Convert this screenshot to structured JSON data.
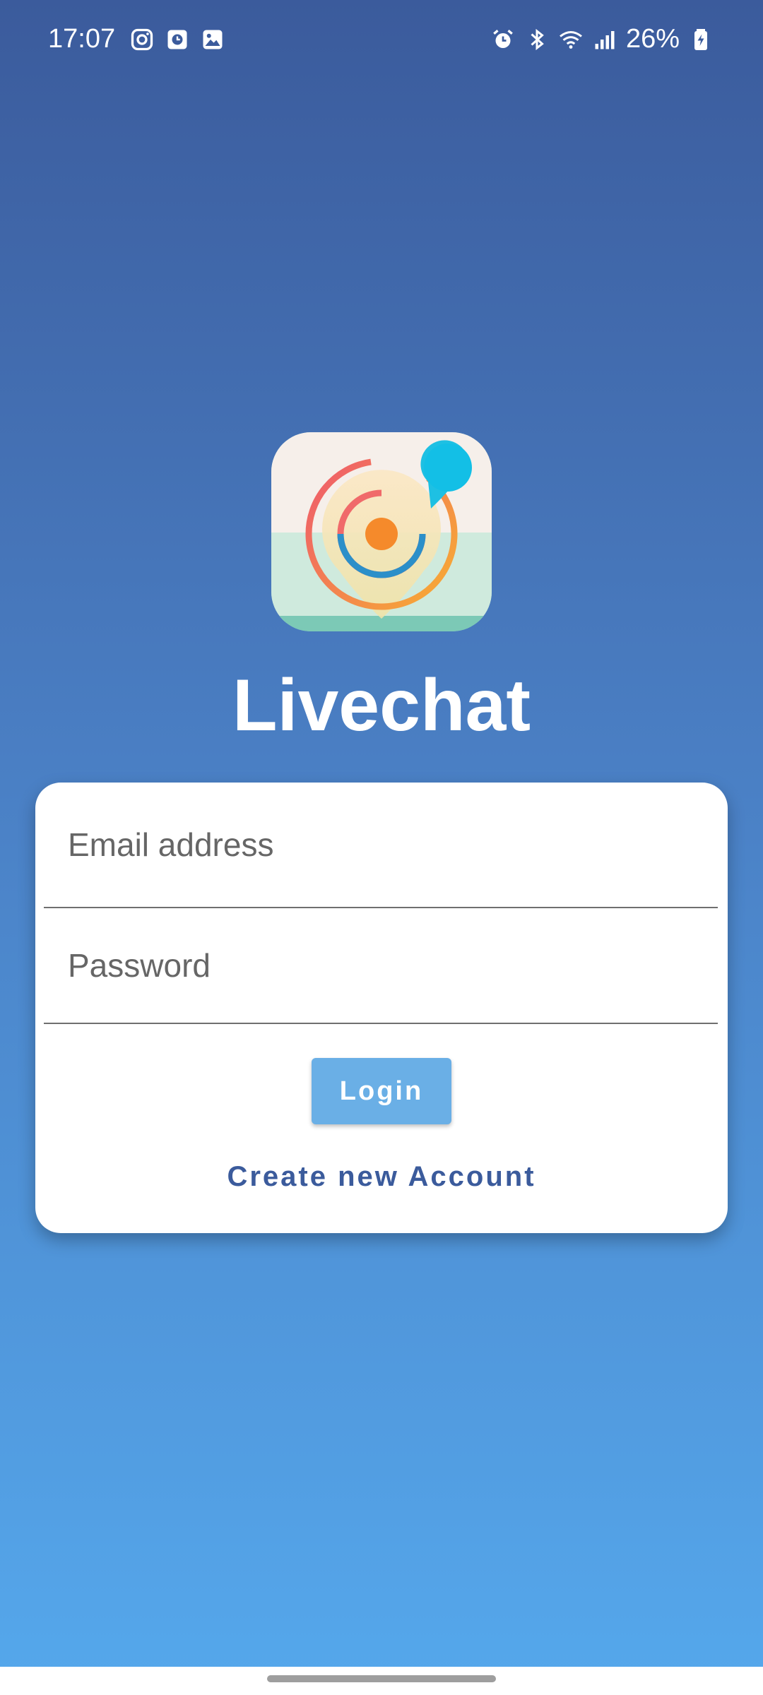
{
  "status_bar": {
    "time": "17:07",
    "battery": "26%",
    "left_icons": [
      "instagram-icon",
      "clock-app-icon",
      "gallery-icon"
    ],
    "right_icons": [
      "alarm-icon",
      "bluetooth-icon",
      "wifi-icon",
      "signal-icon",
      "battery-charging-icon"
    ]
  },
  "app": {
    "title": "Livechat",
    "logo": "livechat-logo-icon"
  },
  "login_form": {
    "email_placeholder": "Email address",
    "email_value": "",
    "password_placeholder": "Password",
    "password_value": "",
    "login_label": "Login",
    "create_account_label": "Create new Account"
  },
  "colors": {
    "gradient_top": "#3b5b9c",
    "gradient_bottom": "#55a8ec",
    "login_button": "#6aafe6",
    "link": "#3b5b9c",
    "card": "#ffffff"
  }
}
